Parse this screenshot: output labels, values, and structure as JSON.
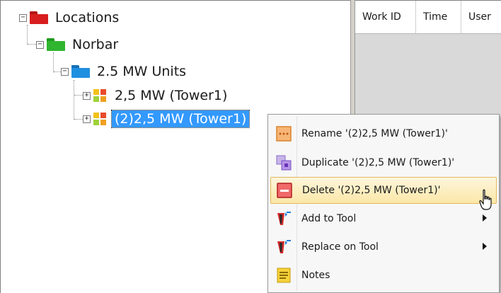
{
  "tree": {
    "root": {
      "label": "Locations",
      "expander": "−",
      "icon_color": "#d81e1e"
    },
    "child": {
      "label": "Norbar",
      "expander": "−",
      "icon_color": "#2fb52f"
    },
    "group": {
      "label": "2.5 MW Units",
      "expander": "−",
      "icon_color": "#1f8fe0"
    },
    "items": [
      {
        "label": "2,5 MW (Tower1)",
        "expander": "+",
        "selected": false
      },
      {
        "label": "(2)2,5 MW (Tower1)",
        "expander": "+",
        "selected": true
      }
    ]
  },
  "grid": {
    "columns": [
      "Work ID",
      "Time",
      "User"
    ]
  },
  "context_menu": {
    "items": [
      {
        "label": "Rename '(2)2,5 MW (Tower1)'",
        "icon": "rename-icon",
        "highlight": false,
        "submenu": false
      },
      {
        "label": "Duplicate '(2)2,5 MW (Tower1)'",
        "icon": "duplicate-icon",
        "highlight": false,
        "submenu": false
      },
      {
        "label": "Delete '(2)2,5 MW (Tower1)'",
        "icon": "delete-icon",
        "highlight": true,
        "submenu": false
      },
      {
        "label": "Add to Tool",
        "icon": "add-to-tool-icon",
        "highlight": false,
        "submenu": true
      },
      {
        "label": "Replace on Tool",
        "icon": "replace-on-tool-icon",
        "highlight": false,
        "submenu": true
      },
      {
        "label": "Notes",
        "icon": "notes-icon",
        "highlight": false,
        "submenu": false
      }
    ]
  },
  "colors": {
    "selection": "#3399ff",
    "menu_highlight_border": "#e3b862"
  }
}
